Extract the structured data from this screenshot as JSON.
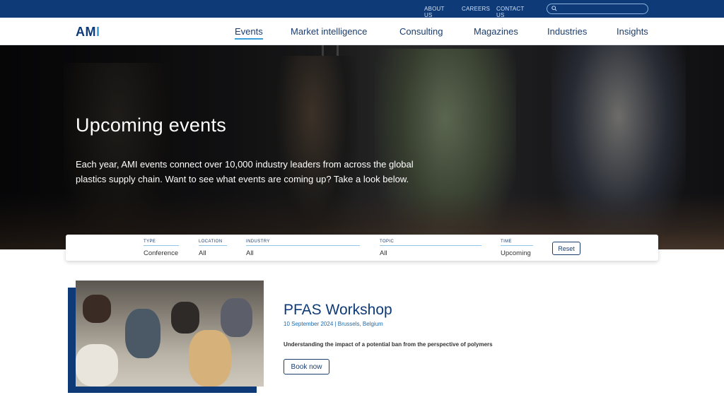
{
  "topbar": {
    "links": [
      "ABOUT US",
      "CAREERS",
      "CONTACT US"
    ],
    "search_placeholder": ""
  },
  "brand": {
    "logo_text_a": "AM",
    "logo_text_b": "I"
  },
  "nav": {
    "items": [
      "Events",
      "Market intelligence",
      "Consulting",
      "Magazines",
      "Industries",
      "Insights"
    ],
    "active": "Events"
  },
  "hero": {
    "title": "Upcoming events",
    "text": "Each year, AMI events connect over 10,000 industry leaders from across the global plastics supply chain. Want to see what events are coming up? Take a look below."
  },
  "filters": {
    "type": {
      "label": "TYPE",
      "value": "Conference"
    },
    "location": {
      "label": "LOCATION",
      "value": "All"
    },
    "industry": {
      "label": "INDUSTRY",
      "value": "All"
    },
    "topic": {
      "label": "TOPIC",
      "value": "All"
    },
    "time": {
      "label": "TIME",
      "value": "Upcoming"
    },
    "reset_label": "Reset"
  },
  "event": {
    "title": "PFAS Workshop",
    "meta": "10 September 2024 | Brussels, Belgium",
    "description": "Understanding the impact of a potential ban from the perspective of polymers",
    "button_label": "Book now"
  },
  "colors": {
    "primary": "#0e3a78",
    "accent": "#3aa0dc",
    "link": "#1b6bb0"
  },
  "icons": {
    "search": "search-icon"
  }
}
